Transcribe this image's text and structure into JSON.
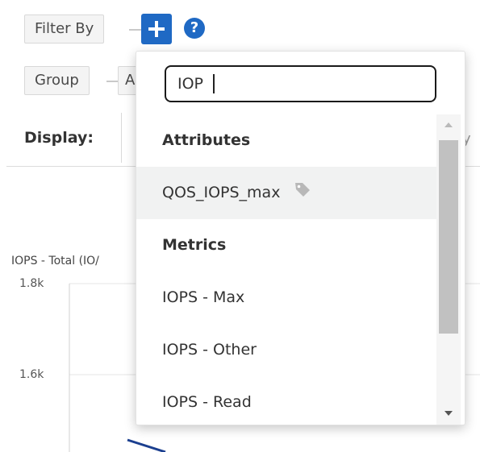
{
  "toolbar": {
    "filter_by_label": "Filter By",
    "group_label": "Group",
    "group_next_chip_partial": "A",
    "display_label": "Display:",
    "display_tail_partial": "y"
  },
  "chart": {
    "title_partial": "IOPS - Total (IO/",
    "ticks": [
      "1.8k",
      "1.6k"
    ]
  },
  "dropdown": {
    "search_value": "IOP",
    "items": [
      {
        "type": "header",
        "label": "Attributes"
      },
      {
        "type": "option",
        "label": "QOS_IOPS_max",
        "icon": "tag-icon",
        "hover": true
      },
      {
        "type": "header",
        "label": "Metrics"
      },
      {
        "type": "option",
        "label": "IOPS - Max"
      },
      {
        "type": "option",
        "label": "IOPS - Other"
      },
      {
        "type": "option",
        "label": "IOPS - Read"
      }
    ]
  },
  "colors": {
    "accent": "#1f69c4",
    "hover_row": "#f1f2f2",
    "scroll_thumb": "#c1c1c1"
  },
  "icons": {
    "add": "plus-icon",
    "help": "question-circle-icon",
    "attribute_tag": "tag-icon"
  }
}
